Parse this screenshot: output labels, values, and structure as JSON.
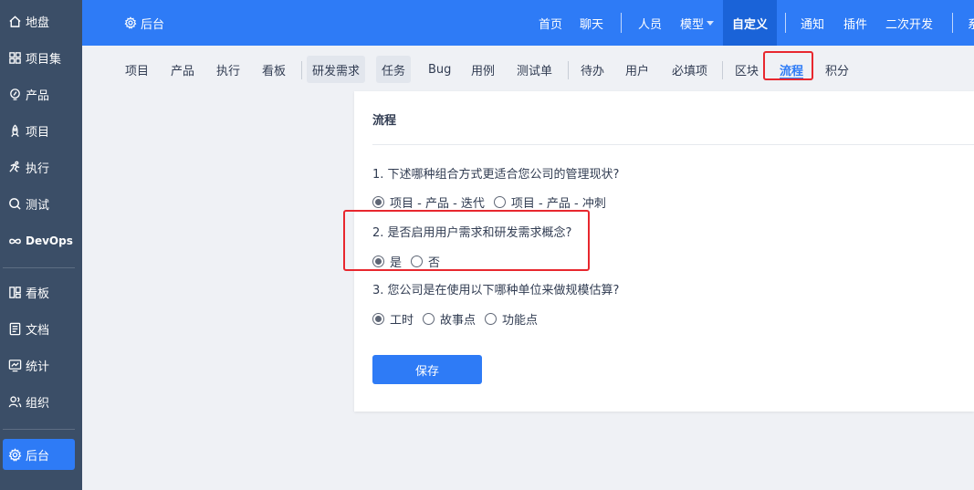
{
  "sidebar": {
    "items": [
      {
        "label": "地盘",
        "icon": "home-icon"
      },
      {
        "label": "项目集",
        "icon": "grid-icon"
      },
      {
        "label": "产品",
        "icon": "lightbulb-icon"
      },
      {
        "label": "项目",
        "icon": "rocket-icon"
      },
      {
        "label": "执行",
        "icon": "run-icon"
      },
      {
        "label": "测试",
        "icon": "magnifier-icon"
      },
      {
        "label": "DevOps",
        "icon": "infinity-icon"
      },
      {
        "label": "看板",
        "icon": "kanban-icon"
      },
      {
        "label": "文档",
        "icon": "document-icon"
      },
      {
        "label": "统计",
        "icon": "chart-icon"
      },
      {
        "label": "组织",
        "icon": "people-icon"
      },
      {
        "label": "后台",
        "icon": "gear-icon"
      }
    ]
  },
  "header": {
    "brand": "后台",
    "nav": [
      "首页",
      "聊天",
      "人员",
      "模型",
      "自定义",
      "通知",
      "插件",
      "二次开发",
      "系"
    ]
  },
  "subnav": [
    "项目",
    "产品",
    "执行",
    "看板",
    "研发需求",
    "任务",
    "Bug",
    "用例",
    "测试单",
    "待办",
    "用户",
    "必填项",
    "区块",
    "流程",
    "积分"
  ],
  "panel": {
    "title": "流程",
    "q1": "1. 下述哪种组合方式更适合您公司的管理现状?",
    "q1_opts": [
      "项目 - 产品 - 迭代",
      "项目 - 产品 - 冲刺"
    ],
    "q2": "2. 是否启用用户需求和研发需求概念?",
    "q2_opts": [
      "是",
      "否"
    ],
    "q3": "3. 您公司是在使用以下哪种单位来做规模估算?",
    "q3_opts": [
      "工时",
      "故事点",
      "功能点"
    ],
    "save": "保存"
  },
  "colors": {
    "primary": "#2e7bf6",
    "sidebar": "#3b4e67",
    "highlight": "#e8272e"
  }
}
